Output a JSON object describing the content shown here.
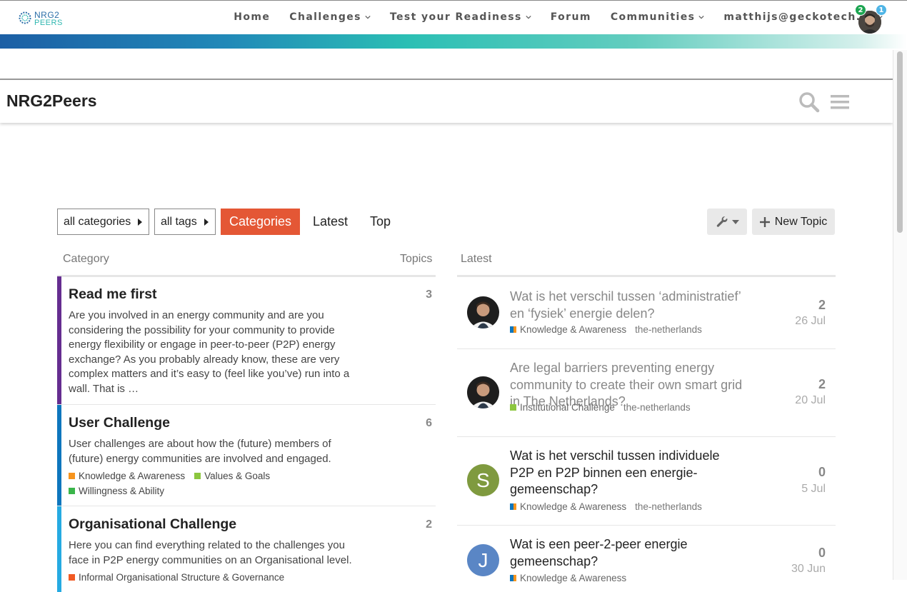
{
  "site": {
    "logo_line1": "NRG2",
    "logo_line2": "PEERS",
    "nav": [
      {
        "label": "Home",
        "dropdown": false
      },
      {
        "label": "Challenges",
        "dropdown": true
      },
      {
        "label": "Test your Readiness",
        "dropdown": true
      },
      {
        "label": "Forum",
        "dropdown": false
      },
      {
        "label": "Communities",
        "dropdown": true
      },
      {
        "label": "matthijs@geckotech.nl",
        "dropdown": true
      }
    ]
  },
  "forum_header": {
    "title": "NRG2Peers",
    "notifications_badge": "2",
    "messages_badge": "1"
  },
  "filters": {
    "categories_dropdown": "all categories",
    "tags_dropdown": "all tags",
    "tabs": [
      "Categories",
      "Latest",
      "Top"
    ],
    "active_tab": "Categories",
    "new_topic_label": "New Topic"
  },
  "columns": {
    "category": "Category",
    "topics": "Topics",
    "latest": "Latest"
  },
  "categories": [
    {
      "name": "Read me first",
      "count": "3",
      "color": "#652d90",
      "description": "Are you involved in an energy community and are you considering the possibility for your community to provide energy flexibility or engage in peer-to-peer (P2P) energy exchange? As you probably already know, these are very complex matters and it’s easy to (feel like you’ve) run into a wall. That is …",
      "subcategories": []
    },
    {
      "name": "User Challenge",
      "count": "6",
      "color": "#0e76bd",
      "description": "User challenges are about how the (future) members of (future) energy communities are involved and engaged.",
      "subcategories": [
        {
          "name": "Knowledge & Awareness",
          "color": "#f7941d"
        },
        {
          "name": "Values & Goals",
          "color": "#8cc63f"
        },
        {
          "name": "Willingness & Ability",
          "color": "#3ab54a"
        }
      ]
    },
    {
      "name": "Organisational Challenge",
      "count": "2",
      "color": "#25aae2",
      "description": "Here you can find everything related to the challenges you face in P2P energy communities on an Organisational level.",
      "subcategories": [
        {
          "name": "Informal Organisational Structure & Governance",
          "color": "#f15a24"
        }
      ]
    }
  ],
  "latest": [
    {
      "title": "Wat is het verschil tussen ‘administratief’ en ‘fysiek’ energie delen?",
      "read": true,
      "avatar_type": "photo",
      "category": "Knowledge & Awareness",
      "category_colors": [
        "#0e76bd",
        "#f7941d"
      ],
      "tag": "the-netherlands",
      "posts": "2",
      "date": "26 Jul"
    },
    {
      "title": "Are legal barriers preventing energy community to create their own smart grid in The Netherlands?",
      "read": true,
      "avatar_type": "photo",
      "category": "Institutional Challenge",
      "category_colors": [
        "#8cc63f",
        "#8cc63f"
      ],
      "tag": "the-netherlands",
      "posts": "2",
      "date": "20 Jul"
    },
    {
      "title": "Wat is het verschil tussen individuele P2P en P2P binnen een energie-gemeenschap?",
      "read": false,
      "avatar_type": "letter",
      "avatar_letter": "S",
      "avatar_color": "#7f9a3f",
      "category": "Knowledge & Awareness",
      "category_colors": [
        "#0e76bd",
        "#f7941d"
      ],
      "tag": "the-netherlands",
      "posts": "0",
      "date": "5 Jul"
    },
    {
      "title": "Wat is een peer-2-peer energie gemeenschap?",
      "read": false,
      "avatar_type": "letter",
      "avatar_letter": "J",
      "avatar_color": "#5a86c5",
      "category": "Knowledge & Awareness",
      "category_colors": [
        "#0e76bd",
        "#f7941d"
      ],
      "tag": "",
      "posts": "0",
      "date": "30 Jun"
    }
  ]
}
